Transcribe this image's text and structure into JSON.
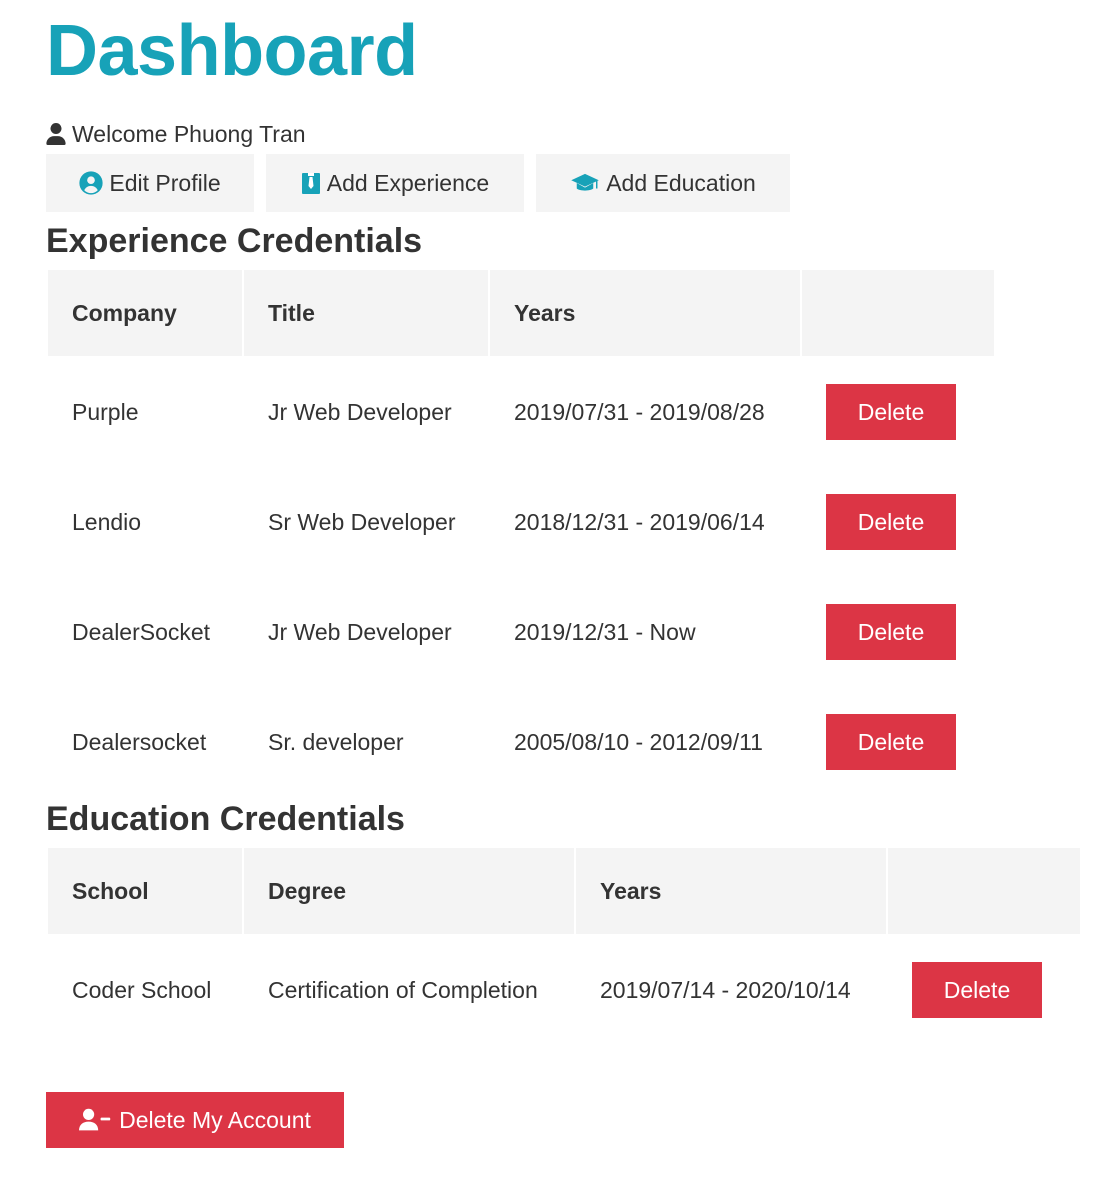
{
  "header": {
    "title": "Dashboard",
    "welcome_text": "Welcome Phuong Tran"
  },
  "actions": {
    "edit_profile": "Edit Profile",
    "add_experience": "Add Experience",
    "add_education": "Add Education"
  },
  "experience": {
    "heading": "Experience Credentials",
    "columns": [
      "Company",
      "Title",
      "Years",
      ""
    ],
    "rows": [
      {
        "company": "Purple",
        "title": "Jr Web Developer",
        "years": "2019/07/31 - 2019/08/28",
        "action": "Delete"
      },
      {
        "company": "Lendio",
        "title": "Sr Web Developer",
        "years": "2018/12/31 - 2019/06/14",
        "action": "Delete"
      },
      {
        "company": "DealerSocket",
        "title": "Jr Web Developer",
        "years": "2019/12/31 - Now",
        "action": "Delete"
      },
      {
        "company": "Dealersocket",
        "title": "Sr. developer",
        "years": "2005/08/10 - 2012/09/11",
        "action": "Delete"
      }
    ]
  },
  "education": {
    "heading": "Education Credentials",
    "columns": [
      "School",
      "Degree",
      "Years",
      ""
    ],
    "rows": [
      {
        "school": "Coder School",
        "degree": "Certification of Completion",
        "years": "2019/07/14 - 2020/10/14",
        "action": "Delete"
      }
    ]
  },
  "footer": {
    "delete_account": "Delete My Account"
  },
  "colors": {
    "primary": "#17a2b8",
    "danger": "#dc3545",
    "light": "#f4f4f4",
    "text": "#333333"
  },
  "icons": {
    "welcome": "user-icon",
    "edit_profile": "user-circle-icon",
    "add_experience": "user-tie-icon",
    "add_education": "graduation-cap-icon",
    "delete_account": "user-minus-icon"
  }
}
